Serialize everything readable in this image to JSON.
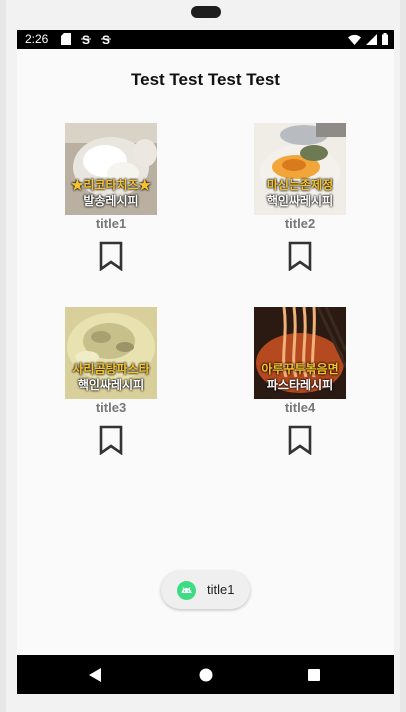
{
  "status_bar": {
    "time": "2:26",
    "icons": [
      "sd-card-icon",
      "s-notification-icon",
      "s-notification-icon",
      "wifi-icon",
      "signal-icon",
      "battery-icon"
    ]
  },
  "app": {
    "title": "Test Test Test Test"
  },
  "items": [
    {
      "title": "title1",
      "caption_line1": "★리코타치즈★",
      "caption_line2": "발송레시피",
      "bookmark_icon": "bookmark-outline-icon"
    },
    {
      "title": "title2",
      "caption_line1": "마신는존제정",
      "caption_line2": "핵인싸레시피",
      "bookmark_icon": "bookmark-outline-icon"
    },
    {
      "title": "title3",
      "caption_line1": "사리곰탕파스타",
      "caption_line2": "핵인싸레시피",
      "bookmark_icon": "bookmark-outline-icon"
    },
    {
      "title": "title4",
      "caption_line1": "아루꾸투볶음면",
      "caption_line2": "파스타레시피",
      "bookmark_icon": "bookmark-outline-icon"
    }
  ],
  "toast": {
    "text": "title1",
    "icon": "android-icon"
  },
  "nav": {
    "buttons": [
      "back-icon",
      "home-icon",
      "recents-icon"
    ]
  },
  "colors": {
    "status_bar": "#000000",
    "toast_icon": "#3ddc84",
    "caption_yellow": "#f7c32b"
  }
}
